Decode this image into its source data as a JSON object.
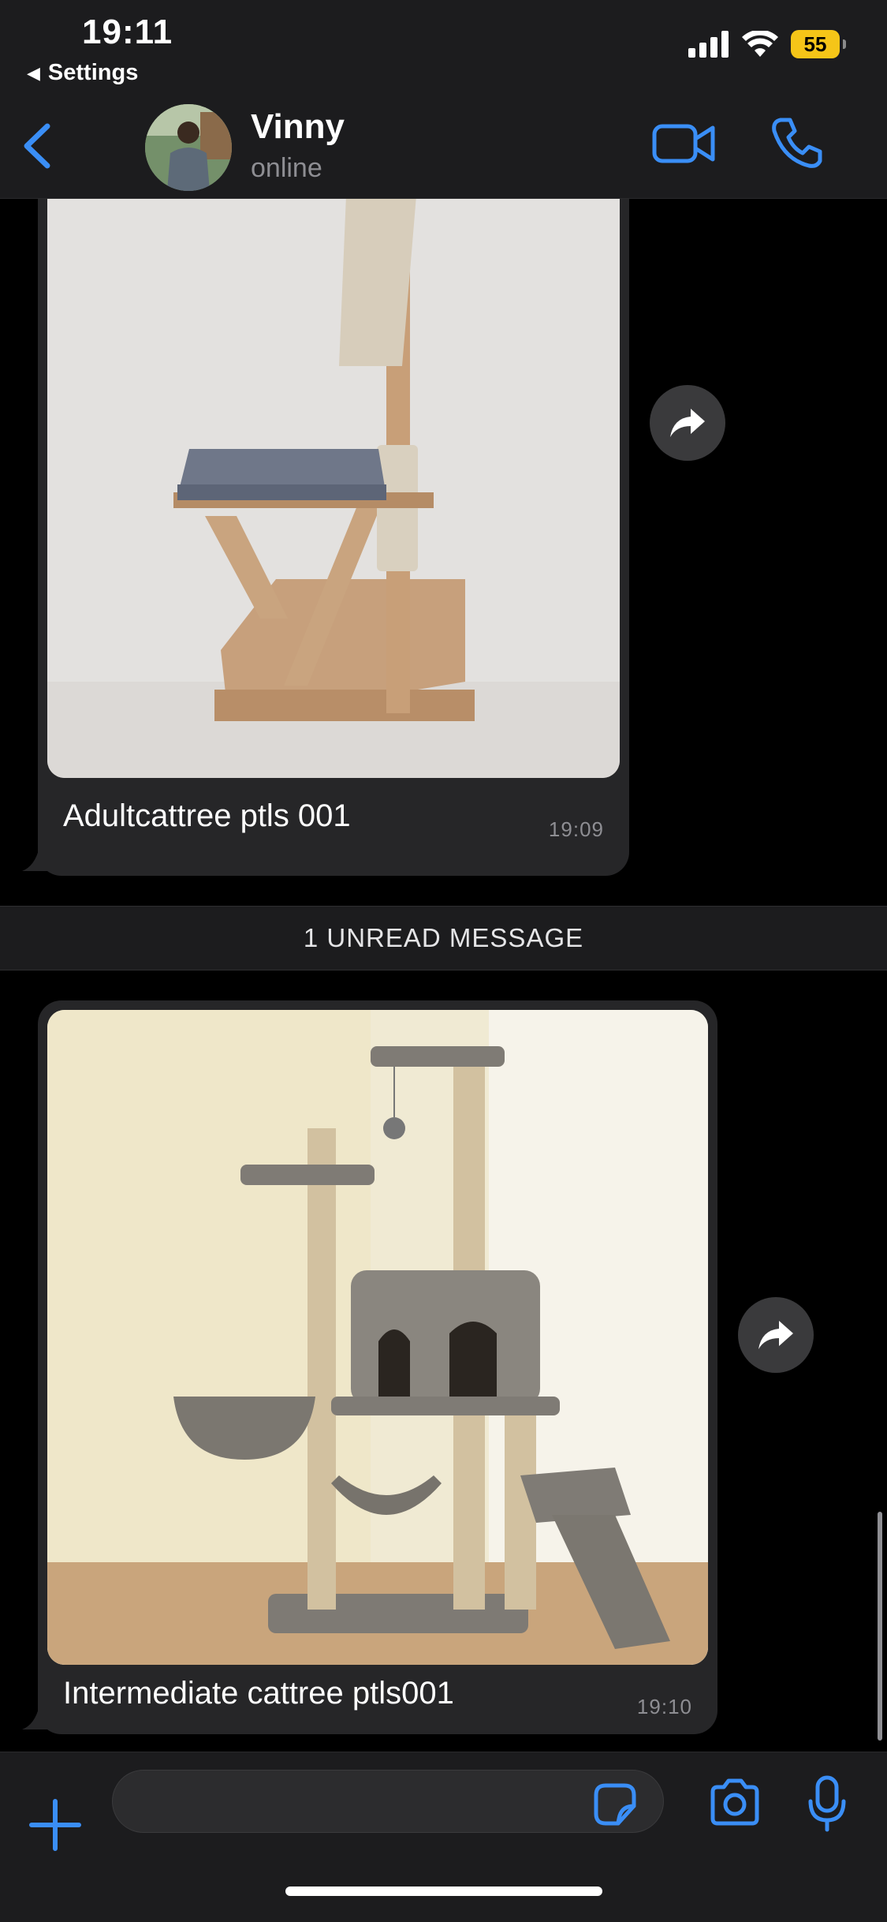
{
  "status_bar": {
    "time": "19:11",
    "back_app": "Settings",
    "battery": "55",
    "battery_color": "#f5c518"
  },
  "header": {
    "contact_name": "Vinny",
    "contact_status": "online",
    "icons": [
      "back-chevron-icon",
      "video-camera-icon",
      "phone-icon"
    ],
    "accent_color": "#3a8ef6"
  },
  "messages": [
    {
      "type": "image",
      "image_subject": "wooden cat tree with sisal posts and grey cushion",
      "caption": "Adultcattree ptls 001",
      "time": "19:09"
    },
    {
      "type": "image",
      "image_subject": "grey carpeted multi-level cat tree with condo and hammock",
      "caption": "Intermediate cattree ptls001",
      "time": "19:10"
    }
  ],
  "unread_banner": "1 UNREAD MESSAGE",
  "composer": {
    "value": "",
    "icons": [
      "plus-icon",
      "sticker-icon",
      "camera-icon",
      "microphone-icon"
    ]
  }
}
